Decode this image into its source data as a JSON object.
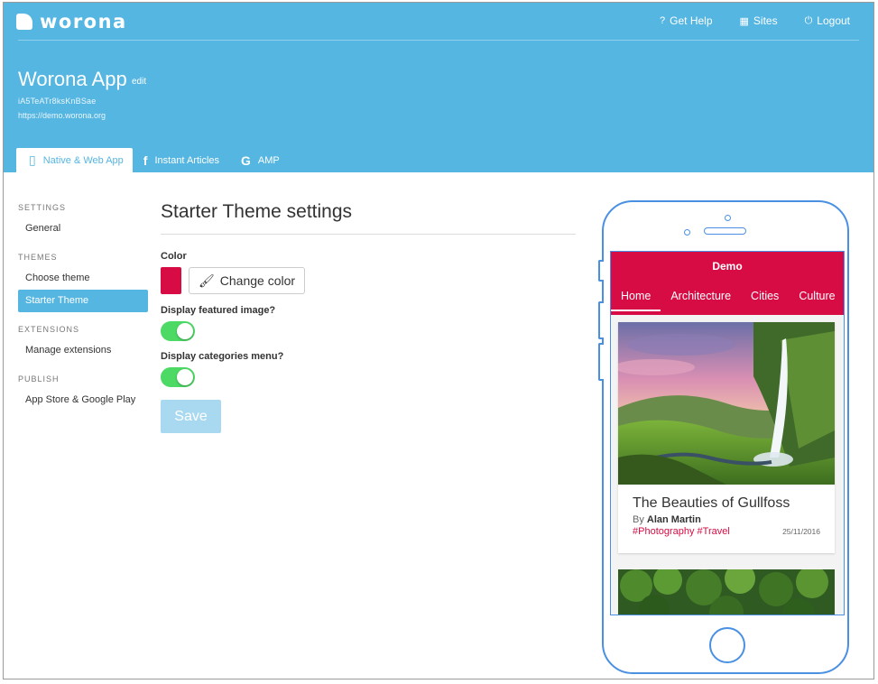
{
  "header": {
    "logo_text": "worona",
    "nav": [
      {
        "icon": "question-circle-icon",
        "glyph": "?",
        "label": "Get Help"
      },
      {
        "icon": "grid-icon",
        "glyph": "▦",
        "label": "Sites"
      },
      {
        "icon": "power-icon",
        "glyph": "⏻",
        "label": "Logout"
      }
    ],
    "app_title": "Worona App",
    "edit_label": "edit",
    "app_id": "iA5TeATr8ksKnBSae",
    "app_url": "https://demo.worona.org",
    "tabs": [
      {
        "icon": "mobile-icon",
        "glyph": "▯",
        "label": "Native & Web App",
        "active": true
      },
      {
        "icon": "facebook-icon",
        "glyph": "f",
        "label": "Instant Articles",
        "active": false
      },
      {
        "icon": "google-icon",
        "glyph": "G",
        "label": "AMP",
        "active": false
      }
    ],
    "bg_color": "#55b6e2"
  },
  "sidebar": {
    "sections": [
      {
        "title": "SETTINGS",
        "items": [
          "General"
        ]
      },
      {
        "title": "THEMES",
        "items": [
          "Choose theme",
          "Starter Theme"
        ],
        "active_item": "Starter Theme"
      },
      {
        "title": "EXTENSIONS",
        "items": [
          "Manage extensions"
        ]
      },
      {
        "title": "PUBLISH",
        "items": [
          "App Store & Google Play"
        ]
      }
    ]
  },
  "main": {
    "title": "Starter Theme settings",
    "color_label": "Color",
    "color_value": "#d70c44",
    "change_color_label": "Change color",
    "featured_image_label": "Display featured image?",
    "featured_image_enabled": true,
    "categories_menu_label": "Display categories menu?",
    "categories_menu_enabled": true,
    "save_label": "Save"
  },
  "preview": {
    "app_bar_title": "Demo",
    "categories": [
      "Home",
      "Architecture",
      "Cities",
      "Culture"
    ],
    "active_category": "Home",
    "post": {
      "title": "The Beauties of Gullfoss",
      "by": "By",
      "author": "Alan Martin",
      "tags": "#Photography #Travel",
      "date": "25/11/2016"
    },
    "accent_color": "#d70c44",
    "frame_color": "#4a90e2"
  }
}
